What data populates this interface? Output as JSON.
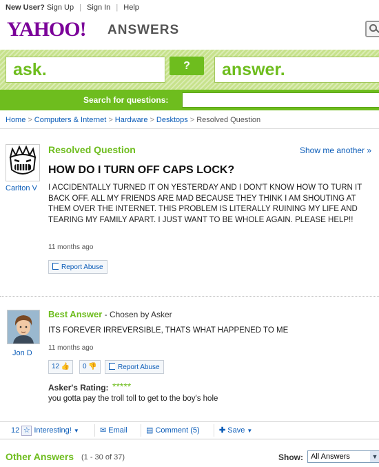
{
  "topnav": {
    "new_user": "New User?",
    "sign_up": "Sign Up",
    "sign_in": "Sign In",
    "help": "Help"
  },
  "header": {
    "logo": "YAHOO!",
    "section": "ANSWERS"
  },
  "band": {
    "ask": "ask.",
    "question_icon": "?",
    "answer": "answer."
  },
  "search": {
    "label": "Search for questions:",
    "value": ""
  },
  "breadcrumb": [
    "Home",
    "Computers & Internet",
    "Hardware",
    "Desktops",
    "Resolved Question"
  ],
  "question": {
    "status": "Resolved Question",
    "show_another": "Show me another »",
    "asker": "Carlton V",
    "title": "HOW DO I TURN OFF CAPS LOCK?",
    "body": "I ACCIDENTALLY TURNED IT ON YESTERDAY AND I DON'T KNOW HOW TO TURN IT BACK OFF. ALL MY FRIENDS ARE MAD BECAUSE THEY THINK I AM SHOUTING AT THEM OVER THE INTERNET. THIS PROBLEM IS LITERALLY RUINING MY LIFE AND TEARING MY FAMILY APART. I JUST WANT TO BE WHOLE AGAIN. PLEASE HELP!!",
    "time": "11 months ago",
    "report": "Report Abuse"
  },
  "best_answer": {
    "label": "Best Answer",
    "chosen": " - Chosen by Asker",
    "answerer": "Jon D",
    "body": "ITS FOREVER IRREVERSIBLE, THATS WHAT HAPPENED TO ME",
    "time": "11 months ago",
    "thumbs_up": "12",
    "thumbs_down": "0",
    "report": "Report Abuse",
    "rating_label": "Asker's Rating:",
    "rating_stars": "*****",
    "rating_comment": "you gotta pay the troll toll to get to the boy's hole"
  },
  "actions": {
    "interesting_count": "12",
    "interesting": "Interesting!",
    "email": "Email",
    "comment": "Comment (5)",
    "save": "Save"
  },
  "other_answers": {
    "title": "Other Answers",
    "count": "(1 - 30 of 37)",
    "show_label": "Show:",
    "show_value": "All Answers"
  },
  "colors": {
    "brand_purple": "#7b0099",
    "accent_green": "#6ebd1e",
    "link_blue": "#0b5cb8"
  }
}
